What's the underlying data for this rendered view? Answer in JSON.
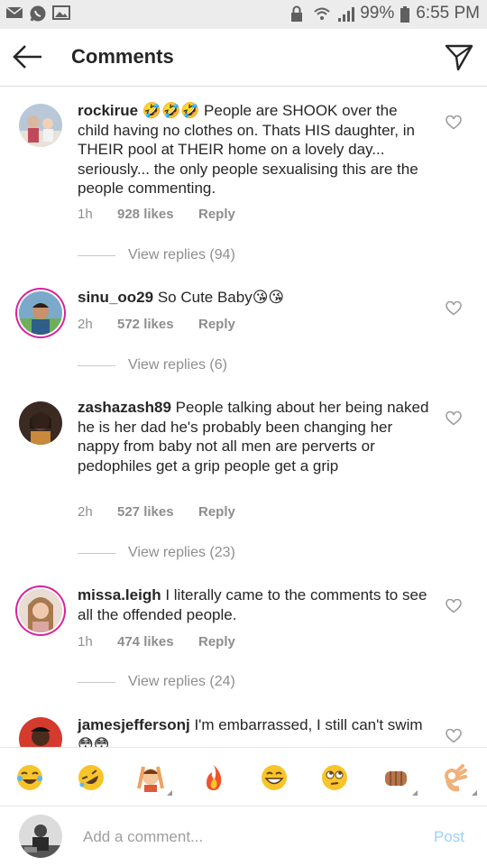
{
  "status_bar": {
    "battery_percent": "99%",
    "time": "6:55 PM",
    "icons": [
      "mail-icon",
      "whatsapp-icon",
      "gallery-icon",
      "lock-icon",
      "wifi-icon",
      "signal-icon",
      "battery-icon"
    ]
  },
  "header": {
    "title": "Comments",
    "back_icon": "back-arrow-icon",
    "send_icon": "direct-send-icon"
  },
  "comments": [
    {
      "username": "rockirue",
      "text": " 🤣🤣🤣 People are SHOOK over the child having no clothes on. Thats HIS daughter, in THEIR  pool at THEIR home on a lovely day... seriously... the only people sexualising this are the people commenting.",
      "time": "1h",
      "likes": "928 likes",
      "reply": "Reply",
      "view_replies": "View replies (94)"
    },
    {
      "username": "sinu_oo29",
      "text": " So Cute Baby😘😘",
      "time": "2h",
      "likes": "572 likes",
      "reply": "Reply",
      "view_replies": "View replies (6)"
    },
    {
      "username": "zashazash89",
      "text": " People talking about her being naked he is her dad he's probably been changing her nappy from baby not all men are perverts or pedophiles get a grip people get a grip",
      "time": "2h",
      "likes": "527 likes",
      "reply": "Reply",
      "view_replies": "View replies (23)"
    },
    {
      "username": "missa.leigh",
      "text": " I literally came to the comments to see all the offended people.",
      "time": "1h",
      "likes": "474 likes",
      "reply": "Reply",
      "view_replies": "View replies (24)"
    },
    {
      "username": "jamesjeffersonj",
      "text": " I'm embarrassed, I still can't swim 😳😳"
    }
  ],
  "emoji_bar": {
    "emojis": [
      "😂",
      "🤣",
      "🙆",
      "🔥",
      "😁",
      "🙄",
      "👊",
      "👌"
    ]
  },
  "composer": {
    "placeholder": "Add a comment...",
    "post_label": "Post"
  }
}
